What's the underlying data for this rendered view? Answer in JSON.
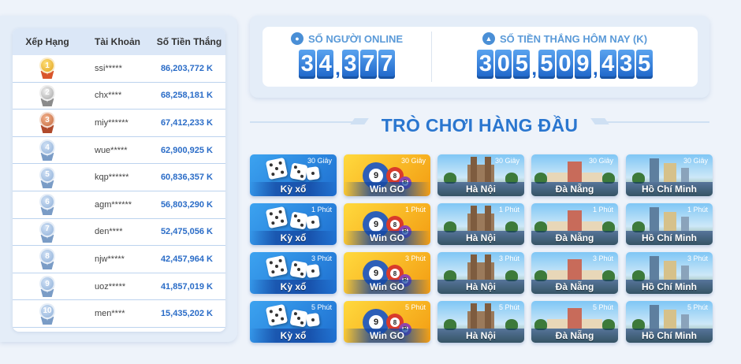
{
  "leaderboard": {
    "headers": {
      "rank": "Xếp Hạng",
      "account": "Tài Khoản",
      "amount": "Số Tiền Thắng"
    },
    "rows": [
      {
        "rank": "1",
        "medal": "gold",
        "account": "ssi*****",
        "amount": "86,203,772 K"
      },
      {
        "rank": "2",
        "medal": "silver",
        "account": "chx****",
        "amount": "68,258,181 K"
      },
      {
        "rank": "3",
        "medal": "bronze",
        "account": "miy******",
        "amount": "67,412,233 K"
      },
      {
        "rank": "4",
        "medal": "blue",
        "account": "wue*****",
        "amount": "62,900,925 K"
      },
      {
        "rank": "5",
        "medal": "blue",
        "account": "kqp******",
        "amount": "60,836,357 K"
      },
      {
        "rank": "6",
        "medal": "blue",
        "account": "agm******",
        "amount": "56,803,290 K"
      },
      {
        "rank": "7",
        "medal": "blue",
        "account": "den****",
        "amount": "52,475,056 K"
      },
      {
        "rank": "8",
        "medal": "blue",
        "account": "njw*****",
        "amount": "42,457,964 K"
      },
      {
        "rank": "9",
        "medal": "blue",
        "account": "uoz*****",
        "amount": "41,857,019 K"
      },
      {
        "rank": "10",
        "medal": "blue",
        "account": "men****",
        "amount": "15,435,202 K"
      }
    ]
  },
  "stats": {
    "online_label": "SỐ NGƯỜI ONLINE",
    "online_value": "34,377",
    "winnings_label": "SỐ TIỀN THẮNG HÔM NAY (K)",
    "winnings_value": "305,509,435"
  },
  "games_title": "TRÒ CHƠI HÀNG ĐẦU",
  "games": [
    {
      "name": "Kỳ xổ",
      "badge": "30 Giây",
      "kind": "k"
    },
    {
      "name": "Win GO",
      "badge": "30 Giây",
      "kind": "w"
    },
    {
      "name": "Hà Nội",
      "badge": "30 Giây",
      "kind": "c"
    },
    {
      "name": "Đà Nẵng",
      "badge": "30 Giây",
      "kind": "c"
    },
    {
      "name": "Hồ Chí Minh",
      "badge": "30 Giây",
      "kind": "c"
    },
    {
      "name": "Kỳ xổ",
      "badge": "1 Phút",
      "kind": "k"
    },
    {
      "name": "Win GO",
      "badge": "1 Phút",
      "kind": "w"
    },
    {
      "name": "Hà Nội",
      "badge": "1 Phút",
      "kind": "c"
    },
    {
      "name": "Đà Nẵng",
      "badge": "1 Phút",
      "kind": "c"
    },
    {
      "name": "Hồ Chí Minh",
      "badge": "1 Phút",
      "kind": "c"
    },
    {
      "name": "Kỳ xổ",
      "badge": "3 Phút",
      "kind": "k"
    },
    {
      "name": "Win GO",
      "badge": "3 Phút",
      "kind": "w"
    },
    {
      "name": "Hà Nội",
      "badge": "3 Phút",
      "kind": "c"
    },
    {
      "name": "Đà Nẵng",
      "badge": "3 Phút",
      "kind": "c"
    },
    {
      "name": "Hồ Chí Minh",
      "badge": "3 Phút",
      "kind": "c"
    },
    {
      "name": "Kỳ xổ",
      "badge": "5 Phút",
      "kind": "k"
    },
    {
      "name": "Win GO",
      "badge": "5 Phút",
      "kind": "w"
    },
    {
      "name": "Hà Nội",
      "badge": "5 Phút",
      "kind": "c"
    },
    {
      "name": "Đà Nẵng",
      "badge": "5 Phút",
      "kind": "c"
    },
    {
      "name": "Hồ Chí Minh",
      "badge": "5 Phút",
      "kind": "c"
    }
  ],
  "colors": {
    "accent": "#2a76cf",
    "amount": "#2a6cc7",
    "digit_top": "#5aa3ef",
    "digit_bottom": "#1c64c8"
  }
}
